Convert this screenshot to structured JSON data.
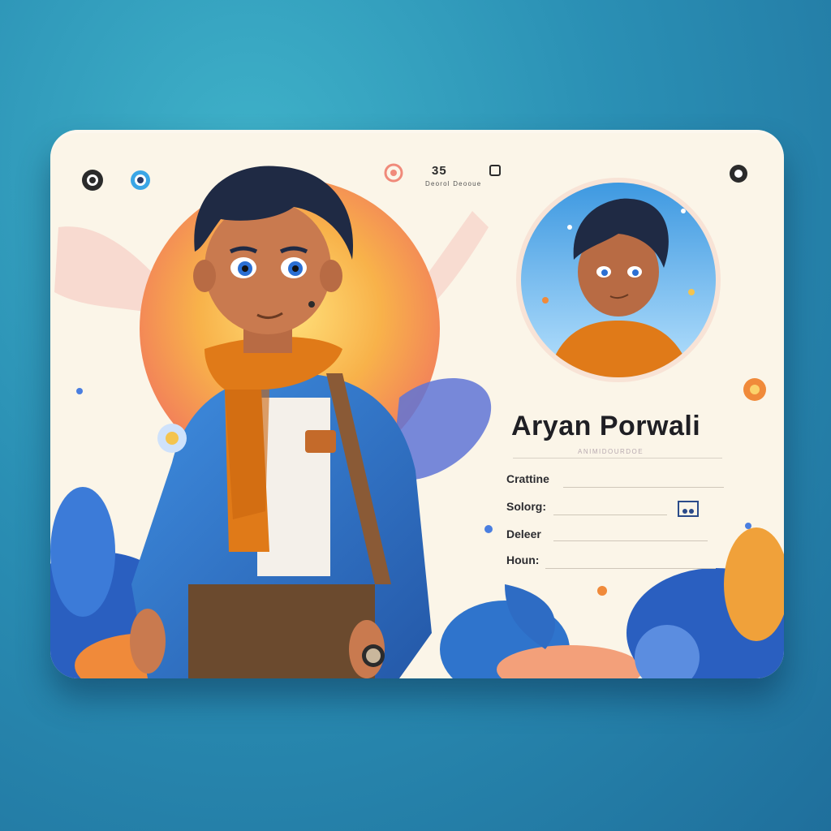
{
  "profile": {
    "name": "Aryan Porwali",
    "subtitle": "ANIMIDOURDOE",
    "counter_value": "35",
    "counter_label": "Deorol Deooue"
  },
  "fields": [
    {
      "label": "Crattine"
    },
    {
      "label": "Solorg:"
    },
    {
      "label": "Deleer"
    },
    {
      "label": "Houn:"
    }
  ],
  "icons": [
    "circle-target-icon",
    "eye-icon",
    "dot-icon",
    "bookmark-icon",
    "settings-icon",
    "image-icon"
  ],
  "colors": {
    "background": "#2a8fb4",
    "card": "#fbf5e8",
    "sun": "#f7b542",
    "scarf": "#e07a18",
    "jacket": "#2f73c6",
    "hair": "#1f2a44",
    "leaf_blue": "#2e6cc4",
    "flower_orange": "#f08a3a"
  }
}
